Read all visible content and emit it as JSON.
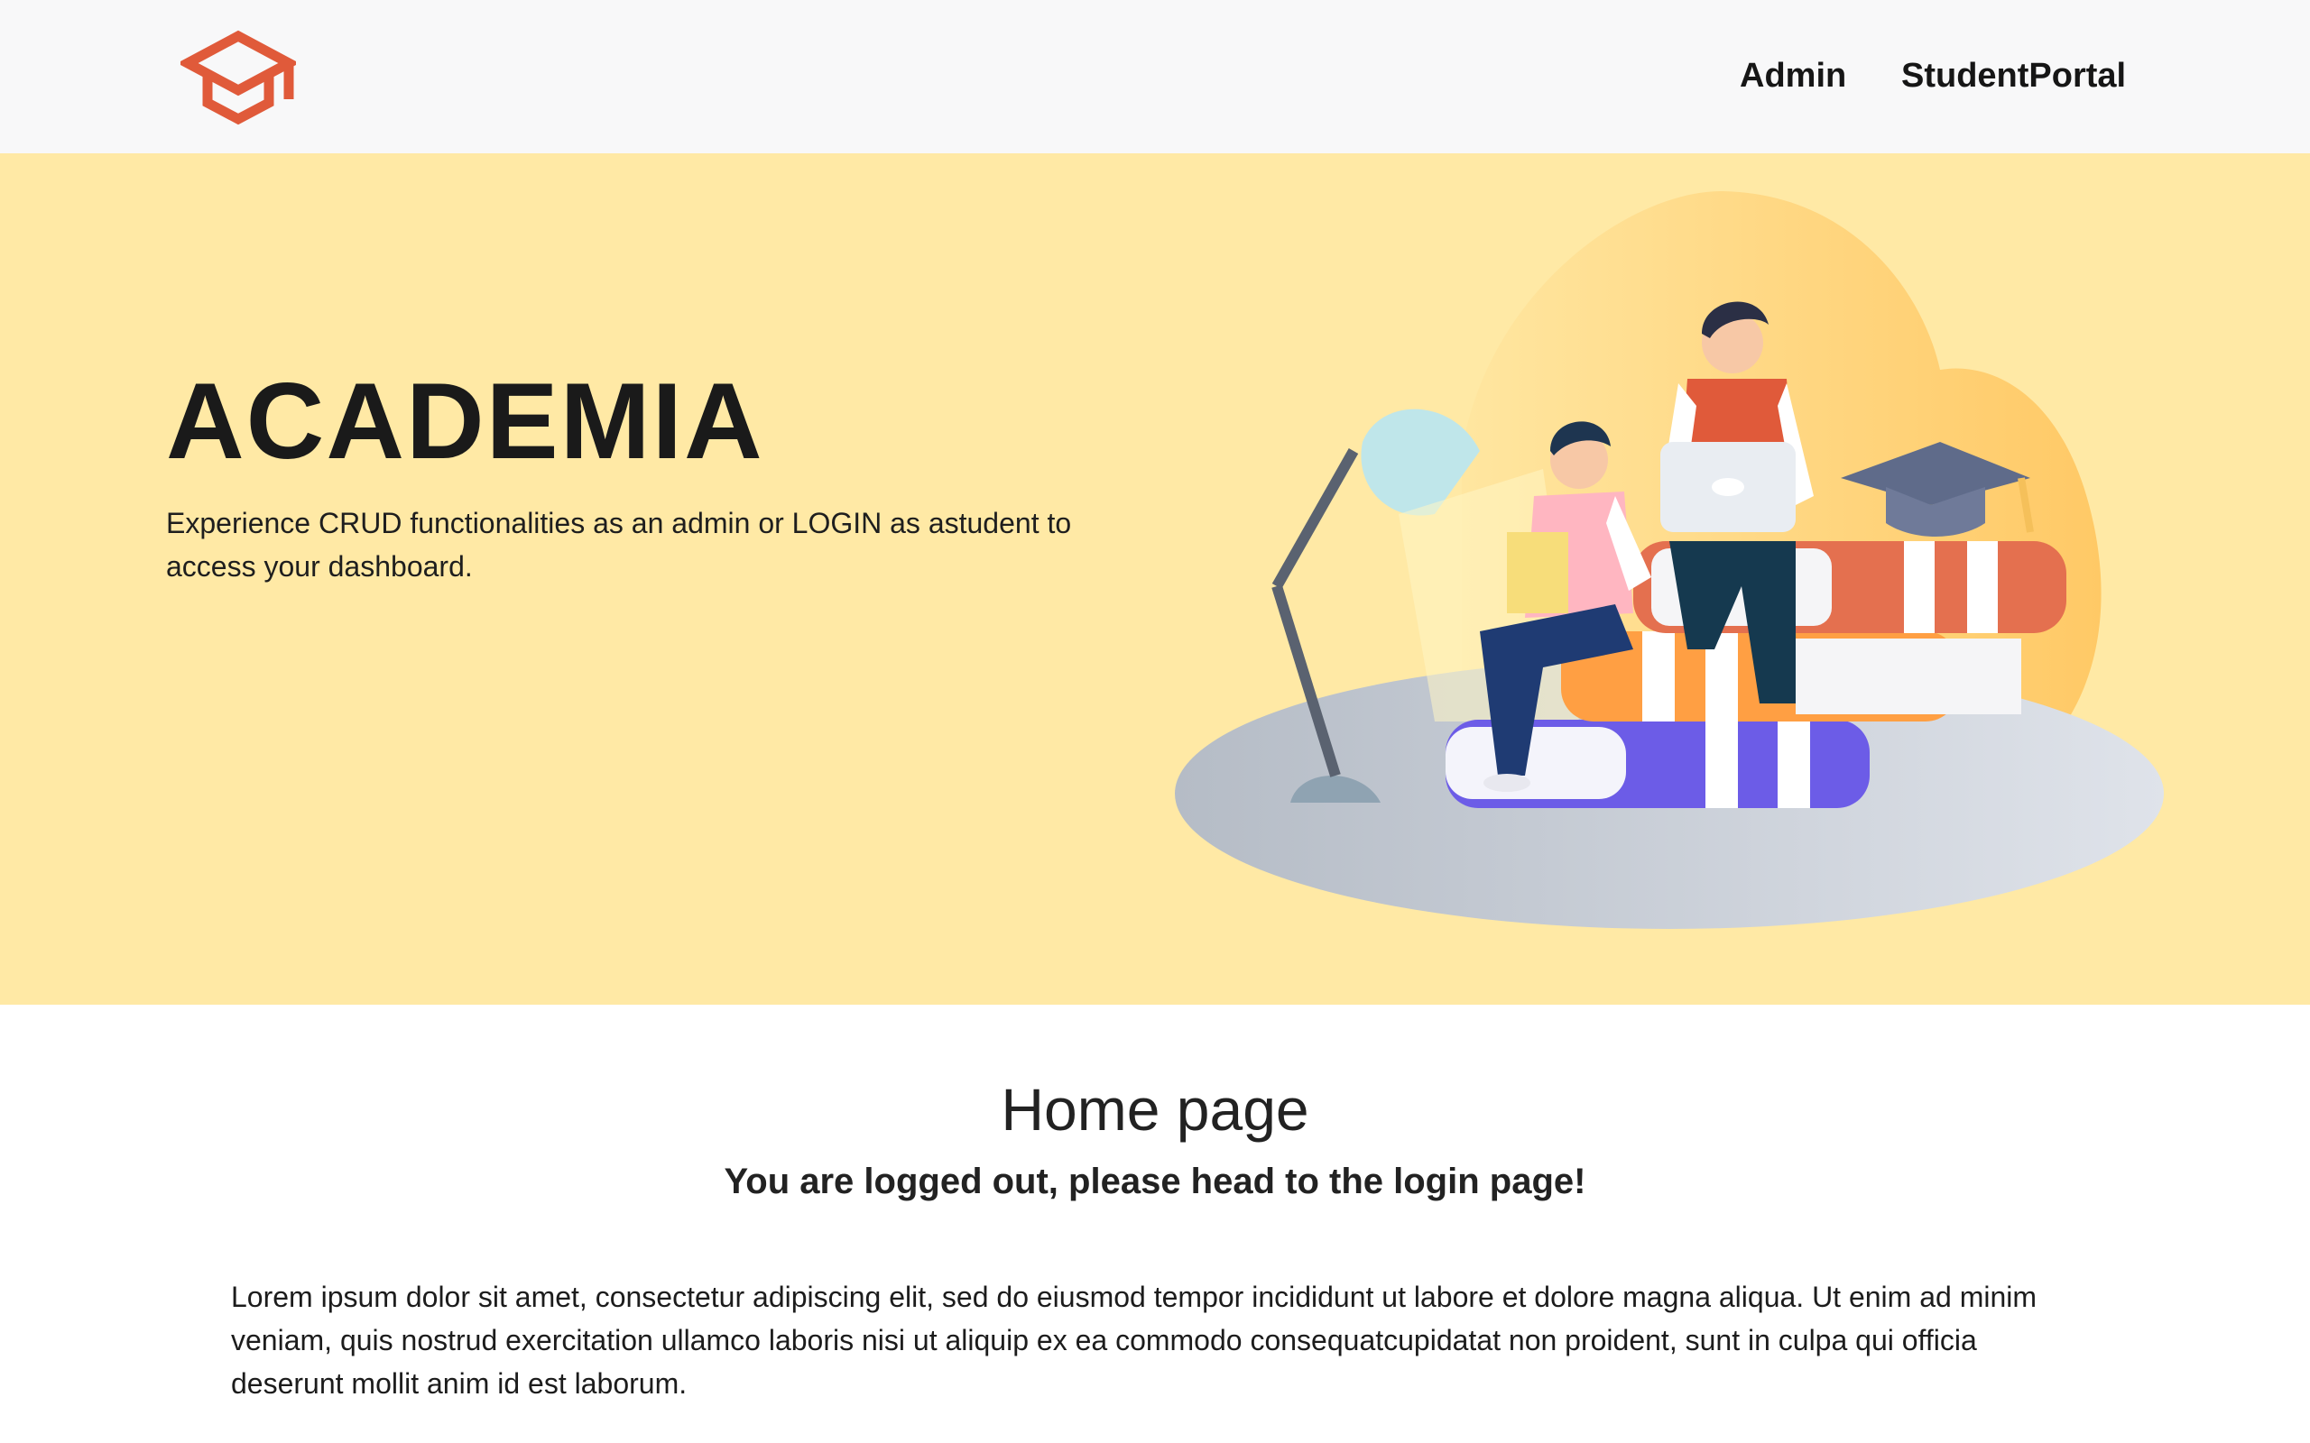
{
  "navbar": {
    "logo_icon": "graduation-cap-icon",
    "links": [
      {
        "label": "Admin"
      },
      {
        "label": "StudentPortal"
      }
    ]
  },
  "hero": {
    "title": "ACADEMIA",
    "description": "Experience CRUD functionalities as an admin or LOGIN as astudent to access your dashboard.",
    "illustration": "students-studying-on-books-illustration"
  },
  "main": {
    "heading": "Home page",
    "subheading": "You are logged out, please head to the login page!",
    "body": "Lorem ipsum dolor sit amet, consectetur adipiscing elit, sed do eiusmod tempor incididunt ut labore et dolore magna aliqua. Ut enim ad minim veniam, quis nostrud exercitation ullamco laboris nisi ut aliquip ex ea commodo consequatcupidatat non proident, sunt in culpa qui officia deserunt mollit anim id est laborum."
  },
  "colors": {
    "brand": "#e05a3a",
    "hero_bg": "#ffe9a5",
    "navbar_bg": "#f8f8f9"
  }
}
